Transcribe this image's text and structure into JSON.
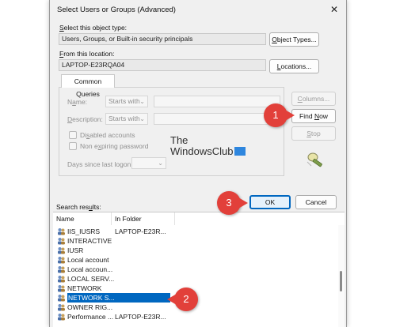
{
  "dialog": {
    "title": "Select Users or Groups (Advanced)",
    "close_glyph": "✕"
  },
  "object_type": {
    "label_prefix": "",
    "label_underline": "S",
    "label_rest": "elect this object type:",
    "value": "Users, Groups, or Built-in security principals",
    "button_underline": "O",
    "button_rest": "bject Types..."
  },
  "location": {
    "label_underline": "F",
    "label_rest": "rom this location:",
    "value": "LAPTOP-E23RQA04",
    "button_underline": "L",
    "button_rest": "ocations..."
  },
  "common_queries": {
    "tab_label": "Common Queries",
    "name_label_pre": "N",
    "name_label_ul": "a",
    "name_label_post": "me:",
    "name_mode": "Starts with",
    "description_label_ul": "D",
    "description_label_post": "escription:",
    "description_mode": "Starts with",
    "disabled_accounts_pre": "Di",
    "disabled_accounts_ul": "s",
    "disabled_accounts_post": "abled accounts",
    "non_expiring_pre": "Non e",
    "non_expiring_ul": "x",
    "non_expiring_post": "piring password",
    "days_label_pre": "Days since last logon:",
    "chevron": "⌄"
  },
  "side_buttons": {
    "columns_ul": "C",
    "columns_rest": "olumns...",
    "find_now_ul": "N",
    "find_now_pre": "Find ",
    "find_now_post": "ow",
    "stop_ul": "S",
    "stop_rest": "top"
  },
  "watermark": {
    "line1": "The",
    "line2": "WindowsClub"
  },
  "actions": {
    "ok": "OK",
    "cancel": "Cancel"
  },
  "results": {
    "label_pre": "Search res",
    "label_ul": "u",
    "label_post": "lts:",
    "columns": [
      "Name",
      "In Folder"
    ],
    "rows": [
      {
        "name": "IIS_IUSRS",
        "folder": "LAPTOP-E23R..."
      },
      {
        "name": "INTERACTIVE",
        "folder": ""
      },
      {
        "name": "IUSR",
        "folder": ""
      },
      {
        "name": "Local account",
        "folder": ""
      },
      {
        "name": "Local accoun...",
        "folder": ""
      },
      {
        "name": "LOCAL SERV...",
        "folder": ""
      },
      {
        "name": "NETWORK",
        "folder": ""
      },
      {
        "name": "NETWORK S...",
        "folder": "",
        "selected": true
      },
      {
        "name": "OWNER RIG...",
        "folder": ""
      },
      {
        "name": "Performance ...",
        "folder": "LAPTOP-E23R..."
      }
    ]
  },
  "callouts": [
    "1",
    "2",
    "3"
  ],
  "colors": {
    "callout": "#e2403a",
    "selection": "#0067c0",
    "ok_border": "#0067c0"
  }
}
